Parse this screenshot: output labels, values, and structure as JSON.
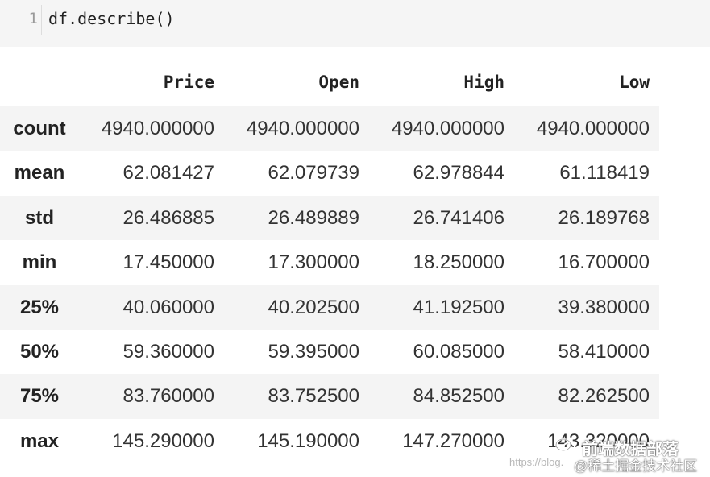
{
  "code_cell": {
    "line_number": "1",
    "code": "df.describe()"
  },
  "table": {
    "columns": [
      "Price",
      "Open",
      "High",
      "Low"
    ],
    "rows": [
      {
        "index": "count",
        "values": [
          "4940.000000",
          "4940.000000",
          "4940.000000",
          "4940.000000"
        ]
      },
      {
        "index": "mean",
        "values": [
          "62.081427",
          "62.079739",
          "62.978844",
          "61.118419"
        ]
      },
      {
        "index": "std",
        "values": [
          "26.486885",
          "26.489889",
          "26.741406",
          "26.189768"
        ]
      },
      {
        "index": "min",
        "values": [
          "17.450000",
          "17.300000",
          "18.250000",
          "16.700000"
        ]
      },
      {
        "index": "25%",
        "values": [
          "40.060000",
          "40.202500",
          "41.192500",
          "39.380000"
        ]
      },
      {
        "index": "50%",
        "values": [
          "59.360000",
          "59.395000",
          "60.085000",
          "58.410000"
        ]
      },
      {
        "index": "75%",
        "values": [
          "83.760000",
          "83.752500",
          "84.852500",
          "82.262500"
        ]
      },
      {
        "index": "max",
        "values": [
          "145.290000",
          "145.190000",
          "147.270000",
          "143.320000"
        ]
      }
    ]
  },
  "watermark": {
    "url_text": "https://blog.",
    "title": "前端数据部落",
    "subtitle": "@稀土掘金技术社区"
  },
  "colors": {
    "input_background": "#f5f5f5",
    "row_stripe": "#f4f4f4"
  }
}
